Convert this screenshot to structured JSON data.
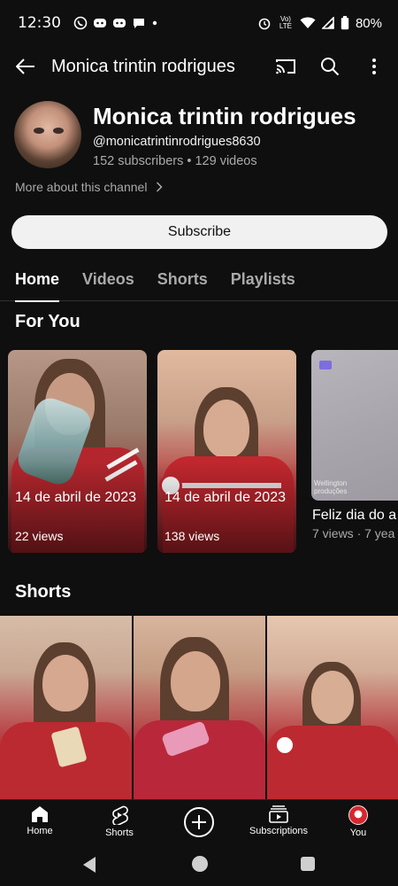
{
  "status_bar": {
    "time": "12:30",
    "network_label": "Vo) LTE",
    "battery": "80%"
  },
  "app_bar": {
    "title": "Monica trintin rodrigues"
  },
  "channel": {
    "name": "Monica trintin rodrigues",
    "handle": "@monicatrintinrodrigues8630",
    "stats": "152 subscribers • 129 videos",
    "more_about": "More about this channel",
    "subscribe_label": "Subscribe"
  },
  "tabs": [
    {
      "label": "Home",
      "active": true
    },
    {
      "label": "Videos",
      "active": false
    },
    {
      "label": "Shorts",
      "active": false
    },
    {
      "label": "Playlists",
      "active": false
    }
  ],
  "for_you": {
    "title": "For You",
    "cards": [
      {
        "title": "14 de abril de 2023",
        "views": "22 views"
      },
      {
        "title": "14 de abril de 2023",
        "views": "138 views"
      }
    ],
    "video": {
      "thumb_text": "Wellington produções",
      "title": "Feliz dia do a",
      "meta": "7 views · 7 yea"
    }
  },
  "shorts_section": {
    "title": "Shorts"
  },
  "bottom_nav": [
    {
      "label": "Home",
      "icon": "home-icon"
    },
    {
      "label": "Shorts",
      "icon": "shorts-icon"
    },
    {
      "label": "",
      "icon": "add-icon"
    },
    {
      "label": "Subscriptions",
      "icon": "subscriptions-icon"
    },
    {
      "label": "You",
      "icon": "you-avatar"
    }
  ],
  "colors": {
    "background": "#0f0f0f",
    "text_secondary": "#aaaaaa",
    "subscribe_bg": "#f1f1f1"
  }
}
